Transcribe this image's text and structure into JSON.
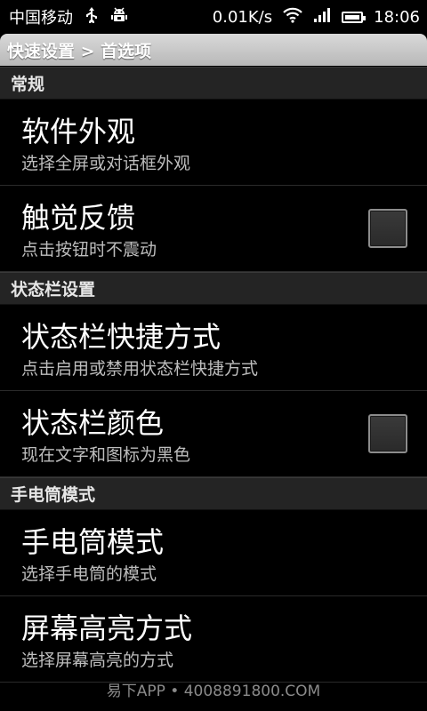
{
  "status_bar": {
    "carrier": "中国移动",
    "usb_icon": "usb-icon",
    "android_icon": "android-debug-icon",
    "net_speed": "0.01K/s",
    "wifi_icon": "wifi-icon",
    "signal_icon": "signal-icon",
    "battery_icon": "battery-icon",
    "time": "18:06"
  },
  "title_bar": {
    "breadcrumb": "快速设置 > 首选项"
  },
  "sections": [
    {
      "header": "常规",
      "items": [
        {
          "title": "软件外观",
          "summary": "选择全屏或对话框外观",
          "has_checkbox": false
        },
        {
          "title": "触觉反馈",
          "summary": "点击按钮时不震动",
          "has_checkbox": true,
          "checked": false
        }
      ]
    },
    {
      "header": "状态栏设置",
      "items": [
        {
          "title": "状态栏快捷方式",
          "summary": "点击启用或禁用状态栏快捷方式",
          "has_checkbox": false
        },
        {
          "title": "状态栏颜色",
          "summary": "现在文字和图标为黑色",
          "has_checkbox": true,
          "checked": false
        }
      ]
    },
    {
      "header": "手电筒模式",
      "items": [
        {
          "title": "手电筒模式",
          "summary": "选择手电筒的模式",
          "has_checkbox": false
        },
        {
          "title": "屏幕高亮方式",
          "summary": "选择屏幕高亮的方式",
          "has_checkbox": false
        }
      ]
    }
  ],
  "watermark": "易下APP • 4008891800.COM",
  "colors": {
    "background": "#000000",
    "section_header": "#242424",
    "title_bar": "#c8c8c8",
    "summary_text": "#bdbdbd"
  }
}
